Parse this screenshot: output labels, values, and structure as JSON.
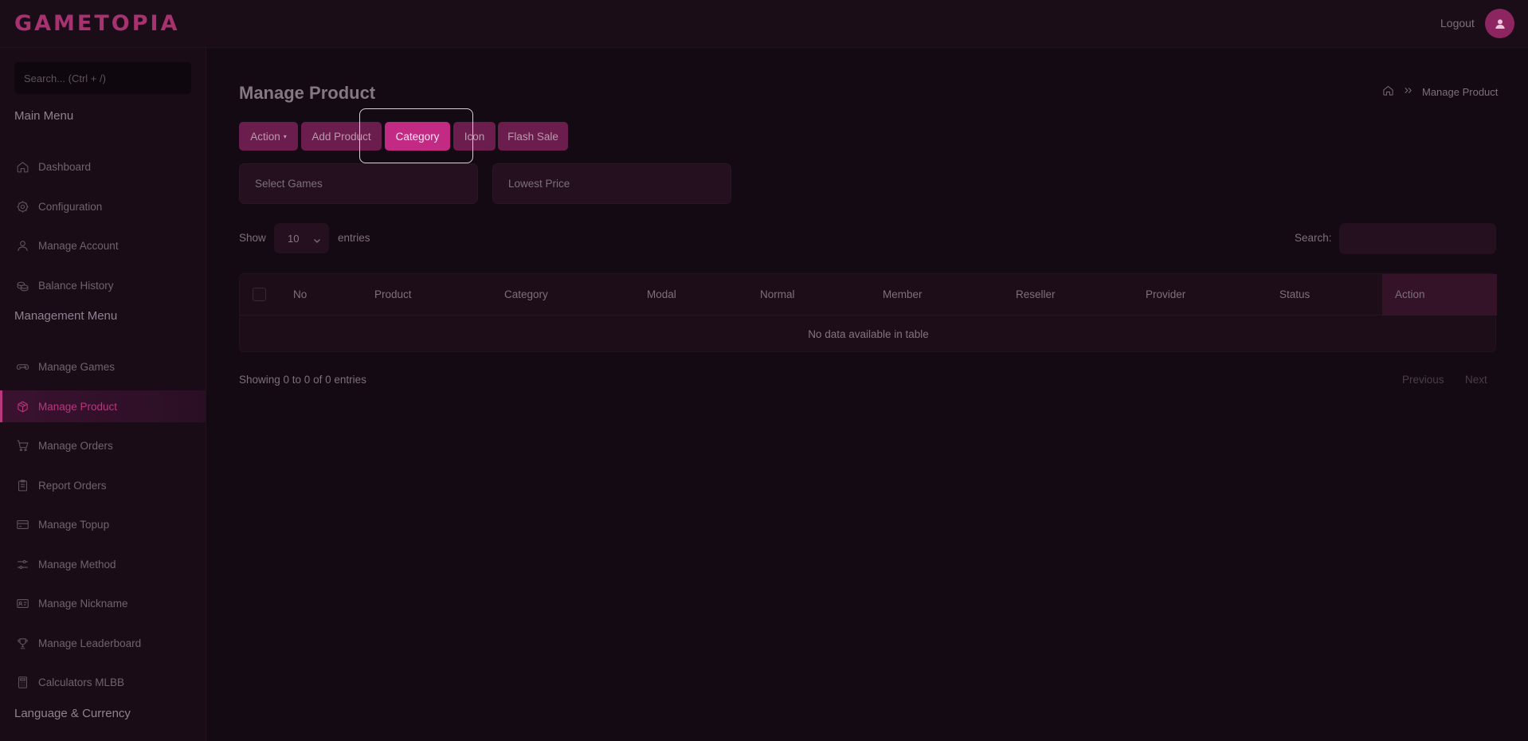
{
  "header": {
    "logo": "GAMETOPIA",
    "logout_label": "Logout"
  },
  "sidebar": {
    "search_placeholder": "Search... (Ctrl + /)",
    "main_menu_title": "Main Menu",
    "main_items": [
      {
        "label": "Dashboard",
        "icon": "home-icon"
      },
      {
        "label": "Configuration",
        "icon": "gear-icon"
      },
      {
        "label": "Manage Account",
        "icon": "user-icon"
      },
      {
        "label": "Balance History",
        "icon": "coins-icon"
      }
    ],
    "management_menu_title": "Management Menu",
    "management_items": [
      {
        "label": "Manage Games",
        "icon": "gamepad-icon"
      },
      {
        "label": "Manage Product",
        "icon": "box-icon",
        "active": true
      },
      {
        "label": "Manage Orders",
        "icon": "cart-icon"
      },
      {
        "label": "Report Orders",
        "icon": "clipboard-icon"
      },
      {
        "label": "Manage Topup",
        "icon": "card-icon"
      },
      {
        "label": "Manage Method",
        "icon": "sliders-icon"
      },
      {
        "label": "Manage Nickname",
        "icon": "id-card-icon"
      },
      {
        "label": "Manage Leaderboard",
        "icon": "trophy-icon"
      },
      {
        "label": "Calculators MLBB",
        "icon": "calculator-icon"
      }
    ],
    "language_title": "Language & Currency"
  },
  "main": {
    "title": "Manage Product",
    "breadcrumb_current": "Manage Product",
    "buttons": {
      "action": "Action",
      "add_product": "Add Product",
      "category": "Category",
      "icon": "Icon",
      "flash_sale": "Flash Sale"
    },
    "filters": {
      "games": "Select Games",
      "price": "Lowest Price"
    },
    "table_controls": {
      "show_label": "Show",
      "entries_value": "10",
      "entries_label": "entries",
      "search_label": "Search:"
    },
    "table": {
      "columns": [
        "No",
        "Product",
        "Category",
        "Modal",
        "Normal",
        "Member",
        "Reseller",
        "Provider",
        "Status",
        "Action"
      ],
      "empty_message": "No data available in table"
    },
    "footer": {
      "showing": "Showing 0 to 0 of 0 entries",
      "previous": "Previous",
      "next": "Next"
    }
  },
  "colors": {
    "accent": "#c22a84",
    "button": "#6b1e4d",
    "background": "#140a13"
  }
}
